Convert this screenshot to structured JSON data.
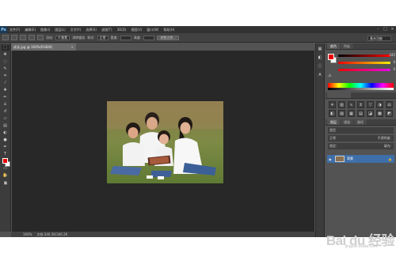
{
  "app": {
    "logo": "Ps"
  },
  "menu": [
    "文件(F)",
    "编辑(E)",
    "图像(I)",
    "图层(L)",
    "文字(Y)",
    "选择(S)",
    "滤镜(T)",
    "3D(D)",
    "视图(V)",
    "窗口(W)",
    "帮助(H)"
  ],
  "window_controls": [
    "–",
    "□",
    "×"
  ],
  "options": {
    "feather_label": "羽化:",
    "feather_value": "0 像素",
    "antialias_label": "消除锯齿",
    "style_label": "样式:",
    "style_value": "正常",
    "width_label": "宽度:",
    "height_label": "高度:",
    "refine_edge": "调整边缘...",
    "workspace": "基本功能"
  },
  "document": {
    "tab_title": "成长.jpg @ 100%(RGB/8)",
    "close": "×"
  },
  "status": {
    "zoom": "100%",
    "doc_info": "文档:340.2K/340.2K"
  },
  "color_panel": {
    "tabs": [
      "颜色",
      "色板"
    ],
    "r": 245,
    "g": 0,
    "b": 0,
    "fg_color": "#e60000",
    "bg_color": "#ffffff"
  },
  "adjustments_panel": {
    "icons": [
      "brightness-icon",
      "levels-icon",
      "curves-icon",
      "exposure-icon",
      "vibrance-icon",
      "hue-icon",
      "balance-icon",
      "bw-icon",
      "photo-filter-icon",
      "channel-mixer-icon",
      "lookup-icon",
      "invert-icon",
      "posterize-icon",
      "threshold-icon"
    ]
  },
  "layers_panel": {
    "tabs": [
      "图层",
      "通道",
      "路径"
    ],
    "kind_filter": "类型",
    "blend_mode": "正常",
    "opacity_label": "不透明度:",
    "lock_label": "锁定:",
    "fill_label": "填充:",
    "layer_name": "背景"
  },
  "watermark": {
    "text": "Bai du 经验",
    "sub": "jingyan.baidu.com"
  }
}
